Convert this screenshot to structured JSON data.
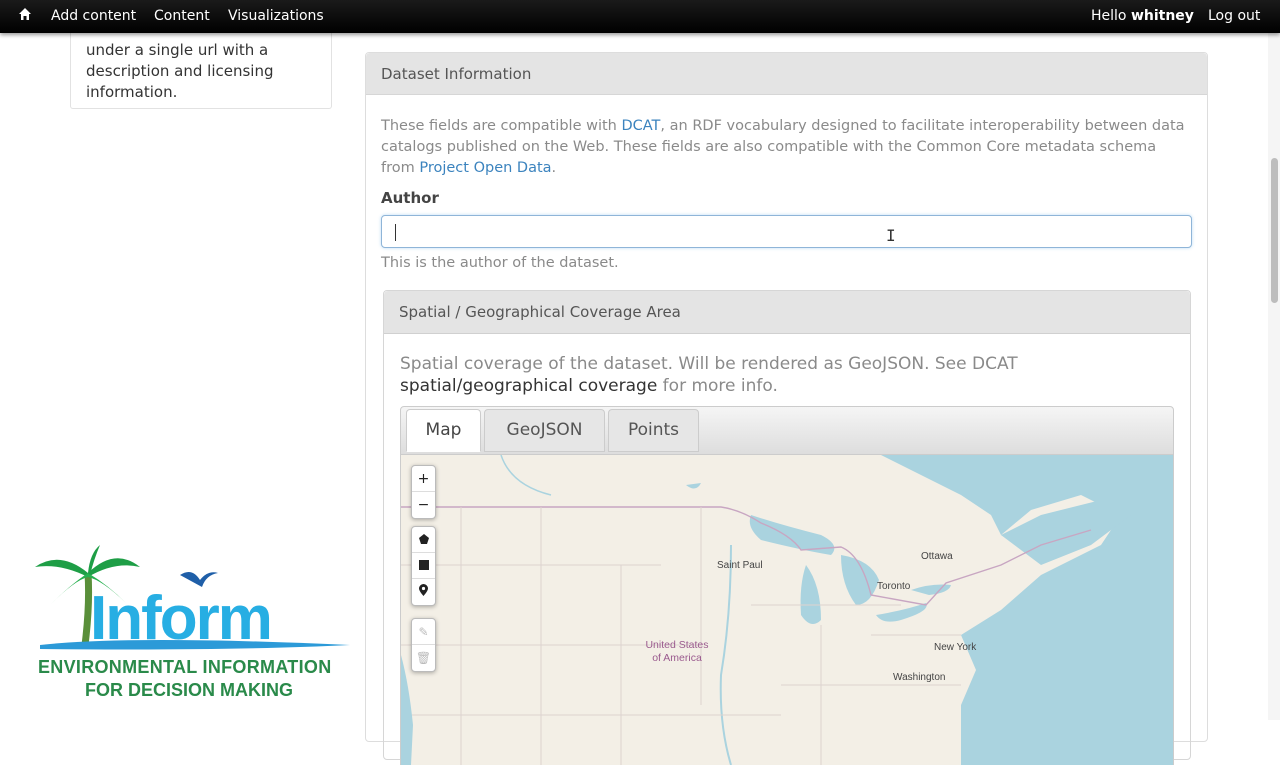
{
  "toolbar": {
    "home_icon": "home-icon",
    "nav": [
      "Add content",
      "Content",
      "Visualizations"
    ],
    "greeting": "Hello ",
    "username": "whitney",
    "logout": "Log out"
  },
  "sidebar": {
    "text": "under a single url with a description and licensing information."
  },
  "dataset": {
    "header": "Dataset Information",
    "desc_1": "These fields are compatible with ",
    "dcat_link": "DCAT",
    "desc_2": ", an RDF vocabulary designed to facilitate interoperability between data catalogs published on the Web. These fields are also compatible with the Common Core metadata schema from ",
    "pod_link": "Project Open Data",
    "desc_3": ".",
    "author_label": "Author",
    "author_value": "",
    "author_help": "This is the author of the dataset."
  },
  "spatial": {
    "header": "Spatial / Geographical Coverage Area",
    "desc_1": "Spatial coverage of the dataset. Will be rendered as GeoJSON. See DCAT",
    "desc_link": "spatial/geographical coverage",
    "desc_2": " for more info.",
    "tabs": [
      "Map",
      "GeoJSON",
      "Points"
    ],
    "active_tab": "Map"
  },
  "map": {
    "controls": {
      "zoom_in": "+",
      "zoom_out": "−",
      "draw_icons": [
        "polygon-icon",
        "rectangle-icon",
        "marker-icon"
      ],
      "edit_icons": [
        "edit-icon",
        "delete-icon"
      ]
    },
    "labels": [
      "Saint Paul",
      "Ottawa",
      "Toronto",
      "New York",
      "Washington"
    ],
    "country_1": "United States",
    "country_2": "of America",
    "colors": {
      "land": "#f3efe6",
      "water": "#aad3df",
      "border": "#c8a6c2"
    }
  },
  "logo": {
    "brand": "Inform",
    "line1": "ENVIRONMENTAL INFORMATION",
    "line2": "FOR DECISION MAKING"
  }
}
